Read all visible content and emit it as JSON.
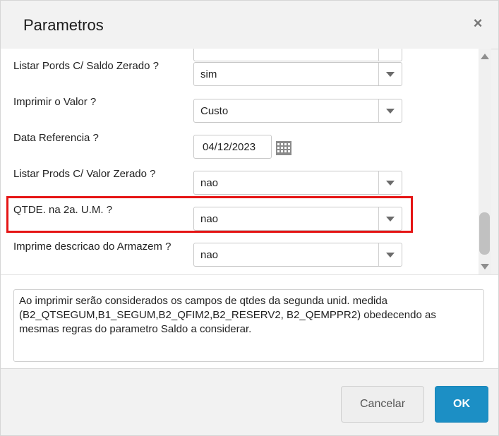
{
  "dialog": {
    "title": "Parametros",
    "close_label": "×"
  },
  "params": [
    {
      "label": "Listar Pords C/ Saldo Zerado ?",
      "value": "sim"
    },
    {
      "label": "Imprimir o Valor ?",
      "value": "Custo"
    },
    {
      "label": "Data Referencia ?",
      "value": "04/12/2023"
    },
    {
      "label": "Listar Prods C/ Valor Zerado ?",
      "value": "nao"
    },
    {
      "label": "QTDE. na 2a. U.M. ?",
      "value": "nao"
    },
    {
      "label": "Imprime descricao do Armazem ?",
      "value": "nao"
    }
  ],
  "description": "Ao imprimir serão considerados os campos de qtdes da segunda unid. medida (B2_QTSEGUM,B1_SEGUM,B2_QFIM2,B2_RESERV2, B2_QEMPPR2) obedecendo as mesmas regras do parametro Saldo a considerar.",
  "buttons": {
    "cancel": "Cancelar",
    "ok": "OK"
  },
  "colors": {
    "highlight": "#e51515",
    "ok_button": "#1c8fc5"
  }
}
